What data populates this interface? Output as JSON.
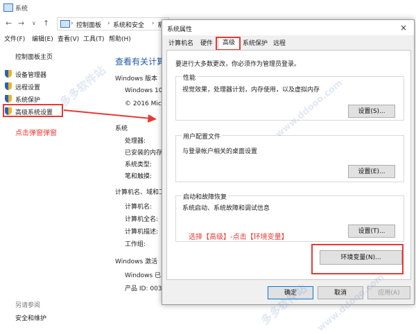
{
  "window": {
    "title": "系统"
  },
  "address": {
    "crumbs": [
      "控制面板",
      "系统和安全",
      "系"
    ]
  },
  "menu": {
    "items": [
      "文件(F)",
      "编辑(E)",
      "查看(V)",
      "工具(T)",
      "帮助(H)"
    ]
  },
  "sidebar": {
    "home": "控制面板主页",
    "items": [
      "设备管理器",
      "远程设置",
      "系统保护",
      "高级系统设置"
    ],
    "note": "点击弹窗弹窗",
    "see_also": "另请参阅",
    "security": "安全和维护"
  },
  "main": {
    "heading": "查看有关计算",
    "windows_edition": "Windows 版本",
    "windows_name": "Windows 10",
    "copyright": "© 2016 Micr",
    "system": "系统",
    "processor": "处理器:",
    "ram": "已安装的内存",
    "system_type": "系统类型:",
    "pen_touch": "笔和触摸:",
    "computer_section": "计算机名、域和工",
    "computer_name": "计算机名:",
    "full_name": "计算机全名:",
    "description": "计算机描述:",
    "workgroup": "工作组:",
    "activation": "Windows 激活",
    "activated": "Windows 已",
    "product_id": "产品 ID: 003"
  },
  "dialog": {
    "title": "系统属性",
    "close": "×",
    "tabs": [
      "计算机名",
      "硬件",
      "高级",
      "系统保护",
      "远程"
    ],
    "admin_note": "要进行大多数更改，你必须作为管理员登录。",
    "performance": {
      "title": "性能",
      "desc": "视觉效果，处理器计划，内存使用，以及虚拟内存",
      "button": "设置(S)..."
    },
    "profiles": {
      "title": "用户配置文件",
      "desc": "与登录帐户相关的桌面设置",
      "button": "设置(E)..."
    },
    "startup": {
      "title": "启动和故障恢复",
      "desc": "系统启动、系统故障和调试信息",
      "button": "设置(T)..."
    },
    "hint": "选择【高级】-点击【环境变量】",
    "env_button": "环境变量(N)...",
    "ok": "确定",
    "cancel": "取消",
    "apply": "应用(A)"
  },
  "watermark": {
    "a": "多多软件站",
    "b": "www.ddooo.com"
  },
  "colors": {
    "annotation": "#e53935",
    "link": "#1e5aa8"
  }
}
